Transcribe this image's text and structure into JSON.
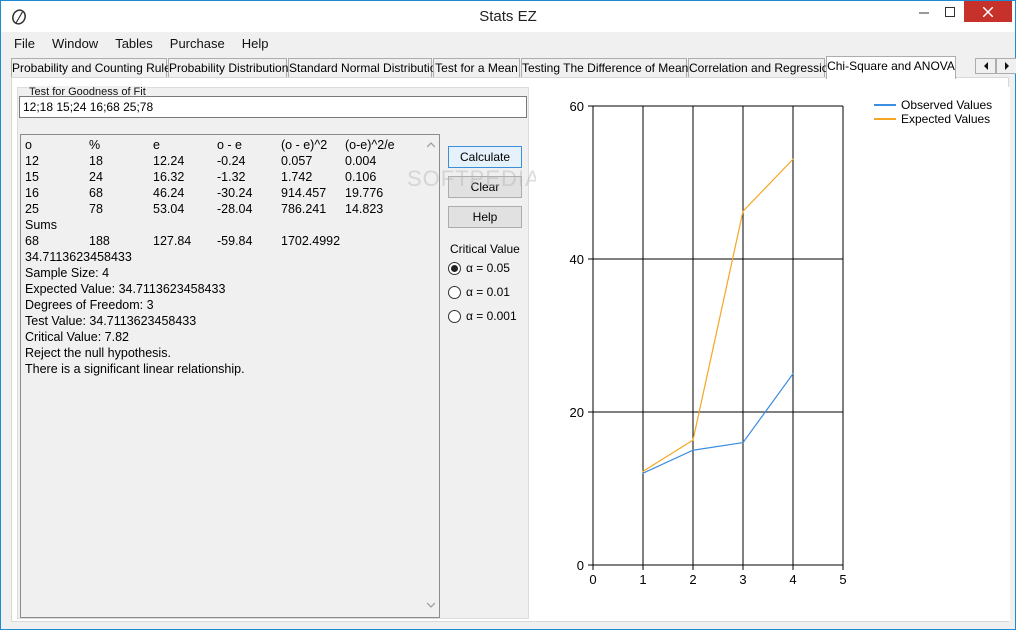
{
  "window": {
    "title": "Stats EZ"
  },
  "menu": [
    "File",
    "Window",
    "Tables",
    "Purchase",
    "Help"
  ],
  "tabs": [
    "Probability and Counting Rules",
    "Probability Distributions",
    "Standard Normal Distribution",
    "Test for a Mean",
    "Testing The Difference of Means",
    "Correlation and Regression",
    "Chi-Square and ANOVA"
  ],
  "active_tab": 6,
  "group": {
    "label": "Test for Goodness of Fit",
    "input_value": "12;18 15;24 16;68 25;78"
  },
  "output": {
    "columns": [
      "o",
      "%",
      "e",
      "o - e",
      "(o - e)^2",
      "(o-e)^2/e"
    ],
    "rows": [
      [
        "12",
        "18",
        "12.24",
        "-0.24",
        "0.057",
        "0.004"
      ],
      [
        "15",
        "24",
        "16.32",
        "-1.32",
        "1.742",
        "0.106"
      ],
      [
        "16",
        "68",
        "46.24",
        "-30.24",
        "914.457",
        "19.776"
      ],
      [
        "25",
        "78",
        "53.04",
        "-28.04",
        "786.241",
        "14.823"
      ]
    ],
    "sums_label": "Sums",
    "sums": [
      "68",
      "188",
      "127.84",
      "-59.84",
      "1702.4992",
      ""
    ],
    "lines": [
      "34.7113623458433",
      "Sample Size: 4",
      "Expected Value: 34.7113623458433",
      "Degrees of Freedom: 3",
      "Test Value: 34.7113623458433",
      "Critical Value: 7.82",
      "Reject the null hypothesis.",
      "There is a significant linear relationship."
    ]
  },
  "buttons": {
    "calculate": "Calculate",
    "clear": "Clear",
    "help": "Help"
  },
  "critical": {
    "label": "Critical Value",
    "options": [
      "α = 0.05",
      "α = 0.01",
      "α = 0.001"
    ],
    "selected": 0
  },
  "watermark": "SOFTPEDIA",
  "chart_data": {
    "type": "line",
    "x": [
      1,
      2,
      3,
      4
    ],
    "series": [
      {
        "name": "Observed Values",
        "values": [
          12,
          15,
          16,
          25
        ],
        "color": "#3c8ee0"
      },
      {
        "name": "Expected Values",
        "values": [
          12.24,
          16.32,
          46.24,
          53.04
        ],
        "color": "#f5a623"
      }
    ],
    "xlim": [
      0,
      5
    ],
    "ylim": [
      0,
      60
    ],
    "xticks": [
      0,
      1,
      2,
      3,
      4,
      5
    ],
    "yticks": [
      0,
      20,
      40,
      60
    ],
    "grid": true,
    "legend": "top-right"
  }
}
